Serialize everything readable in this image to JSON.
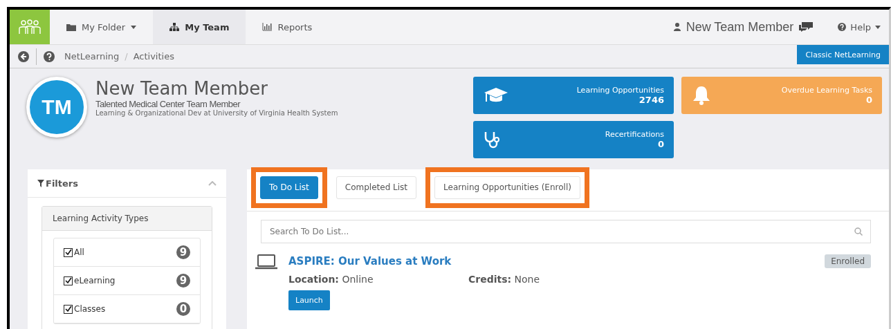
{
  "nav": {
    "items": [
      {
        "label": "My Folder",
        "kind": "folder",
        "dropdown": true,
        "selected": false
      },
      {
        "label": "My Team",
        "kind": "org",
        "dropdown": false,
        "selected": true
      },
      {
        "label": "Reports",
        "kind": "chart",
        "dropdown": false,
        "selected": false
      }
    ],
    "user": "New Team Member",
    "help": "Help"
  },
  "breadcrumb": {
    "items": [
      "NetLearning",
      "Activities"
    ],
    "separator": "/",
    "button": "Classic NetLearning"
  },
  "profile": {
    "initials": "TM",
    "name": "New Team Member",
    "title": "Talented Medical Center Team Member",
    "org": "Learning & Organizational Dev at University of Virginia Health System"
  },
  "stat_cards": [
    {
      "kind": "graduation",
      "label": "Learning Opportunities",
      "value": "2746",
      "color": "#1582c5"
    },
    {
      "kind": "bell",
      "label": "Overdue Learning Tasks",
      "value": "0",
      "color": "#f5a855"
    },
    {
      "kind": "stethoscope",
      "label": "Recertifications",
      "value": "0",
      "color": "#1582c5"
    }
  ],
  "filters": {
    "title": "Filters",
    "section": "Learning Activity Types",
    "items": [
      {
        "label": "All",
        "count": "9",
        "checked": true
      },
      {
        "label": "eLearning",
        "count": "9",
        "checked": true
      },
      {
        "label": "Classes",
        "count": "0",
        "checked": true
      }
    ]
  },
  "tabs": [
    {
      "label": "To Do List",
      "selected": true,
      "highlighted": true
    },
    {
      "label": "Completed List",
      "selected": false,
      "highlighted": false
    },
    {
      "label": "Learning Opportunities (Enroll)",
      "selected": false,
      "highlighted": true
    }
  ],
  "search": {
    "placeholder": "Search To Do List..."
  },
  "activities": [
    {
      "title": "ASPIRE: Our Values at Work",
      "location_label": "Location:",
      "location": "Online",
      "credits_label": "Credits:",
      "credits": "None",
      "status": "Enrolled",
      "action": "Launch"
    }
  ]
}
